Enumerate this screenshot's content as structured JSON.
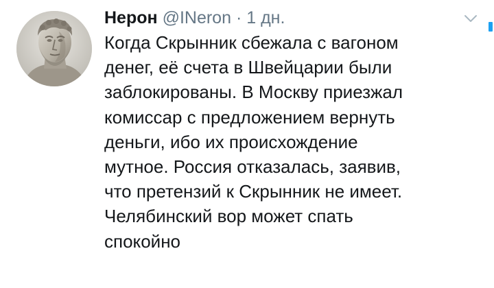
{
  "tweet": {
    "author_name": "Нерон",
    "handle": "@INeron",
    "separator": "·",
    "time": "1 дн.",
    "text_lines": [
      "Когда Скрынник сбежала с вагоном",
      "денег, её счета в Швейцарии были",
      "заблокированы. В Москву приезжал",
      "комиссар с предложением вернуть",
      "деньги, ибо их происхождение",
      "мутное. Россия отказалась, заявив,",
      "что претензий к Скрынник не имеет.",
      "Челябинский вор может спать",
      "спокойно"
    ]
  },
  "icons": {
    "avatar": "marble-bust-avatar",
    "menu": "chevron-down-icon"
  },
  "colors": {
    "text": "#14171a",
    "secondary": "#657786",
    "caret": "#aab8c2",
    "accent": "#1da1f2",
    "background": "#ffffff"
  }
}
